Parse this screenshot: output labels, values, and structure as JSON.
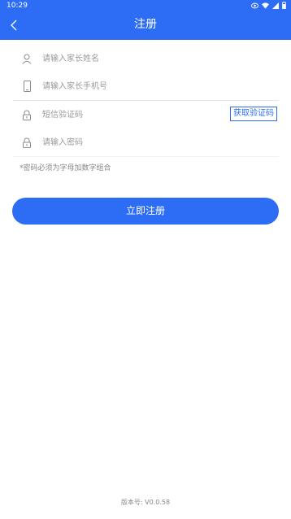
{
  "status_bar": {
    "time": "10:29"
  },
  "nav": {
    "title": "注册"
  },
  "form": {
    "parent_name": {
      "placeholder": "请输入家长姓名"
    },
    "parent_phone": {
      "placeholder": "请输入家长手机号"
    },
    "sms_code": {
      "placeholder": "短信验证码"
    },
    "password": {
      "placeholder": "请输入密码"
    },
    "get_code_label": "获取验证码",
    "password_hint": "*密码必须为字母加数字组合"
  },
  "actions": {
    "register_label": "立即注册"
  },
  "footer": {
    "version_label": "版本号: V0.0.58"
  },
  "colors": {
    "primary": "#2d6df6"
  },
  "icons": {
    "back": "back-chevron-icon",
    "user": "user-icon",
    "phone": "phone-icon",
    "lock": "lock-icon"
  }
}
